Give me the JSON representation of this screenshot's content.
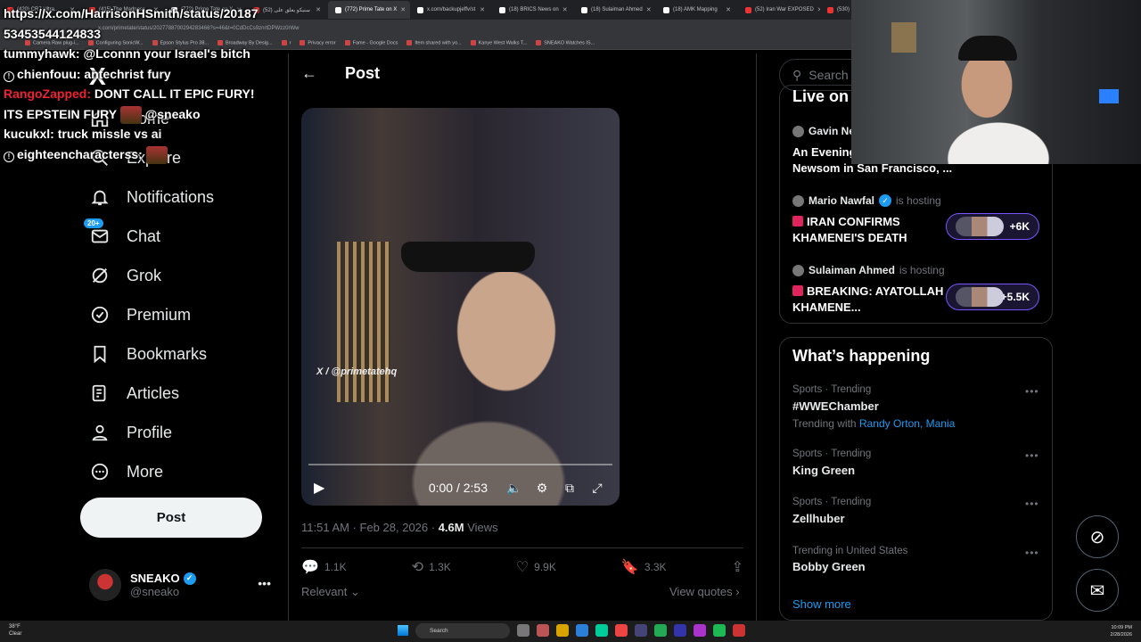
{
  "browser": {
    "tabs": [
      {
        "label": "(420) CR7 Ultra..."
      },
      {
        "label": "(415) The Madness..."
      },
      {
        "label": "(772) Prime Tate on X"
      },
      {
        "label": "(52) سنيكو يعلق على"
      },
      {
        "label": "(772) Prime Tate on X",
        "active": true
      },
      {
        "label": "x.com/backupjeffv/st"
      },
      {
        "label": "(18) BRICS News on"
      },
      {
        "label": "(18) Sulaiman Ahmed"
      },
      {
        "label": "(18) AMK Mapping"
      },
      {
        "label": "(52) Iran War EXPOSED"
      },
      {
        "label": "(530) E"
      }
    ],
    "url": "x.com/primetate/status/2027788700294283466?s=46&t=0CdDcCs9znrtDPWzz0rWw",
    "bookmarks": [
      "Camera Raw plug-i...",
      "Configuring SonicW...",
      "Epson Stylus Pro 38...",
      "Broadway By Desig...",
      "r",
      "Privacy error",
      "Fame - Google Docs",
      "Item shared with yo...",
      "Kanye West Walks T...",
      "SNEAKO Watches IS..."
    ]
  },
  "chat": [
    {
      "user": "",
      "text": "https://x.com/HarrisonHSmith/status/2018753453544124833",
      "style": "plain"
    },
    {
      "user": "tummyhawk:",
      "text": " @Lconnn your Israel's bitch",
      "style": "white"
    },
    {
      "user": "chienfouu:",
      "text": " antechrist fury",
      "style": "warn"
    },
    {
      "user": "RangoZapped:",
      "text": " DONT CALL IT EPIC FURY! ITS EPSTEIN FURY",
      "suffix": " @sneako",
      "style": "red"
    },
    {
      "user": "kucukxl:",
      "text": " truck missle vs ai",
      "style": "white"
    },
    {
      "user": "eighteencharacterss:",
      "text": "",
      "style": "warn"
    }
  ],
  "nav": {
    "logo": "X",
    "items": [
      {
        "label": "Home",
        "icon": "home-icon"
      },
      {
        "label": "Explore",
        "icon": "search-icon"
      },
      {
        "label": "Notifications",
        "icon": "bell-icon"
      },
      {
        "label": "Chat",
        "icon": "mail-icon",
        "badge": "20+"
      },
      {
        "label": "Grok",
        "icon": "grok-icon"
      },
      {
        "label": "Premium",
        "icon": "premium-icon"
      },
      {
        "label": "Bookmarks",
        "icon": "bookmark-icon"
      },
      {
        "label": "Articles",
        "icon": "articles-icon"
      },
      {
        "label": "Profile",
        "icon": "profile-icon"
      },
      {
        "label": "More",
        "icon": "more-circle-icon"
      }
    ],
    "post_button": "Post",
    "account": {
      "name": "SNEAKO",
      "handle": "@sneako"
    }
  },
  "post": {
    "header_title": "Post",
    "video": {
      "watermark": "X / @primetatehq",
      "time": "0:00 / 2:53",
      "progress": 0
    },
    "time": "11:51 AM · Feb 28, 2026",
    "dot": " · ",
    "views_count": "4.6M",
    "views_label": "Views",
    "actions": {
      "replies": "1.1K",
      "reposts": "1.3K",
      "likes": "9.9K",
      "bookmarks": "3.3K"
    },
    "relevant": "Relevant",
    "view_quotes": "View quotes"
  },
  "sidebar": {
    "search_placeholder": "Search",
    "live_title": "Live on X",
    "spaces": [
      {
        "host": "Gavin Ne",
        "hosting": "",
        "title": "An Evening with Gavin Newsom in San Francisco, ...",
        "count": ""
      },
      {
        "host": "Mario Nawfal",
        "hosting": "is hosting",
        "title": "IRAN CONFIRMS KHAMENEI'S DEATH",
        "count": "+6K"
      },
      {
        "host": "Sulaiman Ahmed",
        "hosting": "is hosting",
        "title": "BREAKING: AYATOLLAH KHAMENE...",
        "count": "+5.5K"
      }
    ],
    "happening_title": "What’s happening",
    "trends": [
      {
        "category": "Sports · Trending",
        "name": "#WWEChamber",
        "with_label": "Trending with",
        "with": "Randy Orton, Mania"
      },
      {
        "category": "Sports · Trending",
        "name": "King Green"
      },
      {
        "category": "Sports · Trending",
        "name": "Zellhuber"
      },
      {
        "category": "Trending in United States",
        "name": "Bobby Green"
      }
    ],
    "show_more": "Show more"
  },
  "taskbar": {
    "weather_temp": "38°F",
    "weather_desc": "Clear",
    "search": "Search",
    "time": "10:09 PM",
    "date": "2/28/2026"
  },
  "colors": {
    "accent": "#1d9bf0",
    "background": "#000000",
    "border": "#2f3336",
    "muted": "#71767b",
    "live_purple": "#7856ff"
  }
}
